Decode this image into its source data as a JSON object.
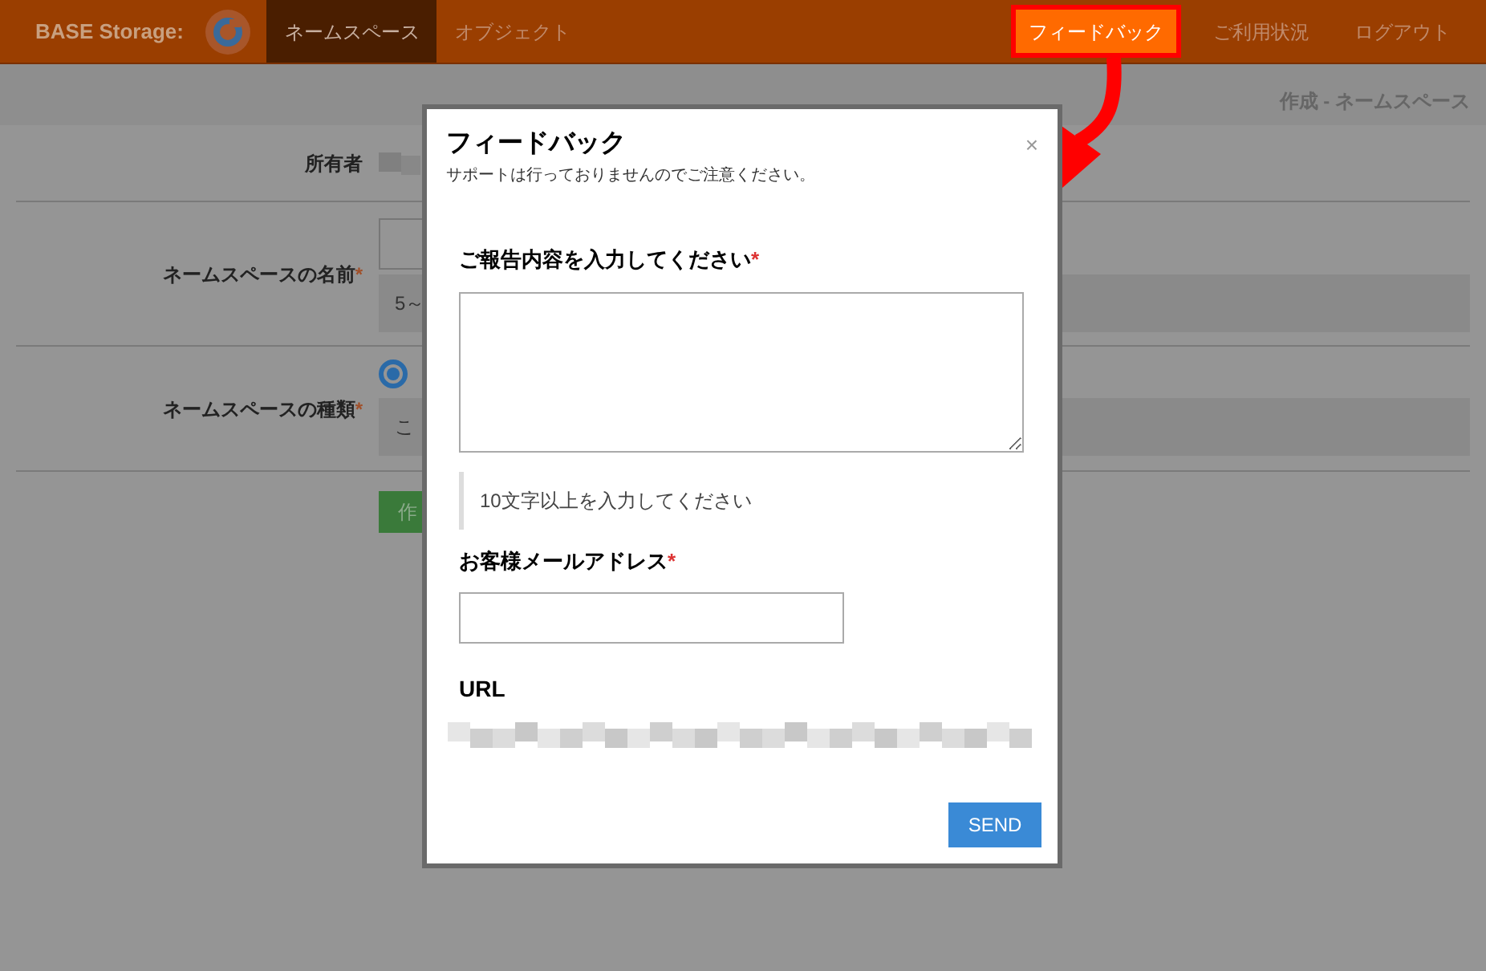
{
  "navbar": {
    "brand": "BASE Storage:",
    "items": [
      {
        "label": "ネームスペース",
        "selected": true
      },
      {
        "label": "オブジェクト",
        "selected": false
      }
    ],
    "right_items": [
      {
        "label": "フィードバック",
        "highlighted": true
      },
      {
        "label": "ご利用状況",
        "highlighted": false
      },
      {
        "label": "ログアウト",
        "highlighted": false
      }
    ]
  },
  "page": {
    "breadcrumb": "作成 - ネームスペース",
    "owner_label": "所有者",
    "name_label": "ネームスペースの名前",
    "name_required": "*",
    "name_hint": "5～",
    "type_label": "ネームスペースの種類",
    "type_required": "*",
    "type_options": [
      {
        "selected": true
      }
    ],
    "type_hint": "こ",
    "create_button": "作"
  },
  "modal": {
    "title": "フィードバック",
    "close": "×",
    "subtitle": "サポートは行っておりませんのでご注意ください。",
    "report_label": "ご報告内容を入力してください",
    "report_required": "*",
    "report_hint": "10文字以上を入力してください",
    "email_label": "お客様メールアドレス",
    "email_required": "*",
    "url_label": "URL",
    "send_button": "SEND"
  }
}
